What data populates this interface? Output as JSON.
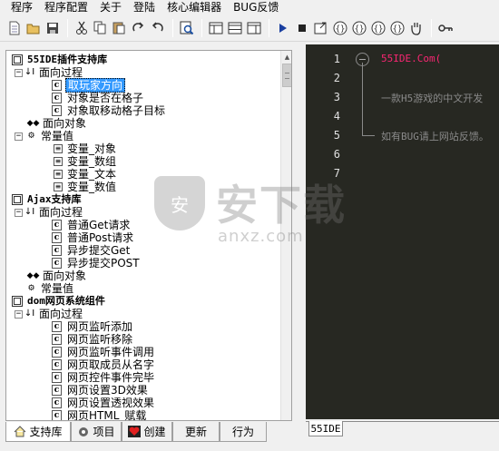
{
  "menu": [
    "程序",
    "程序配置",
    "关于",
    "登陆",
    "核心编辑器",
    "BUG反馈"
  ],
  "toolbar": {
    "buttons": [
      "new-file-icon",
      "open-folder-icon",
      "save-icon",
      "cut-icon",
      "copy-icon",
      "paste-icon",
      "redo-icon",
      "undo-icon",
      "find-icon",
      "layout-left-icon",
      "layout-split-icon",
      "layout-right-icon",
      "run-icon",
      "stop-icon",
      "export-icon",
      "brace-icon",
      "brace-icon",
      "brace-icon",
      "brace-icon",
      "hand-icon",
      "key-icon"
    ]
  },
  "tree": {
    "lib1": {
      "title": "55IDE插件支持库",
      "process": "面向过程",
      "items": [
        "取玩家方向",
        "对象是否在格子",
        "对象取移动格子目标"
      ],
      "object": "面向对象",
      "const": "常量值",
      "consts": [
        "变量_对象",
        "变量_数组",
        "变量_文本",
        "变量_数值"
      ]
    },
    "lib2": {
      "title": "Ajax支持库",
      "process": "面向过程",
      "items": [
        "普通Get请求",
        "普通Post请求",
        "异步提交Get",
        "异步提交POST"
      ],
      "object": "面向对象",
      "const": "常量值"
    },
    "lib3": {
      "title": "dom网页系统组件",
      "process": "面向过程",
      "items": [
        "网页监听添加",
        "网页监听移除",
        "网页监听事件调用",
        "网页取成员从名字",
        "网页控件事件完毕",
        "网页设置3D效果",
        "网页设置透视效果",
        "网页HTML_赋载"
      ]
    }
  },
  "left_tabs": [
    "支持库",
    "项目",
    "创建",
    "更新",
    "行为"
  ],
  "editor": {
    "line_numbers": [
      "1",
      "2",
      "3",
      "4",
      "5",
      "6",
      "7"
    ],
    "lines": [
      "55IDE.Com(",
      "一款H5游戏的中文开发",
      "如有BUG请上网站反馈。"
    ],
    "tab": "55IDE"
  },
  "watermark": {
    "text": "安下载",
    "sub": "anxz.com"
  },
  "colors": {
    "editor_bg": "#272822",
    "keyword": "#f92672",
    "comment": "#8a8a8a",
    "selection": "#3399ff"
  }
}
